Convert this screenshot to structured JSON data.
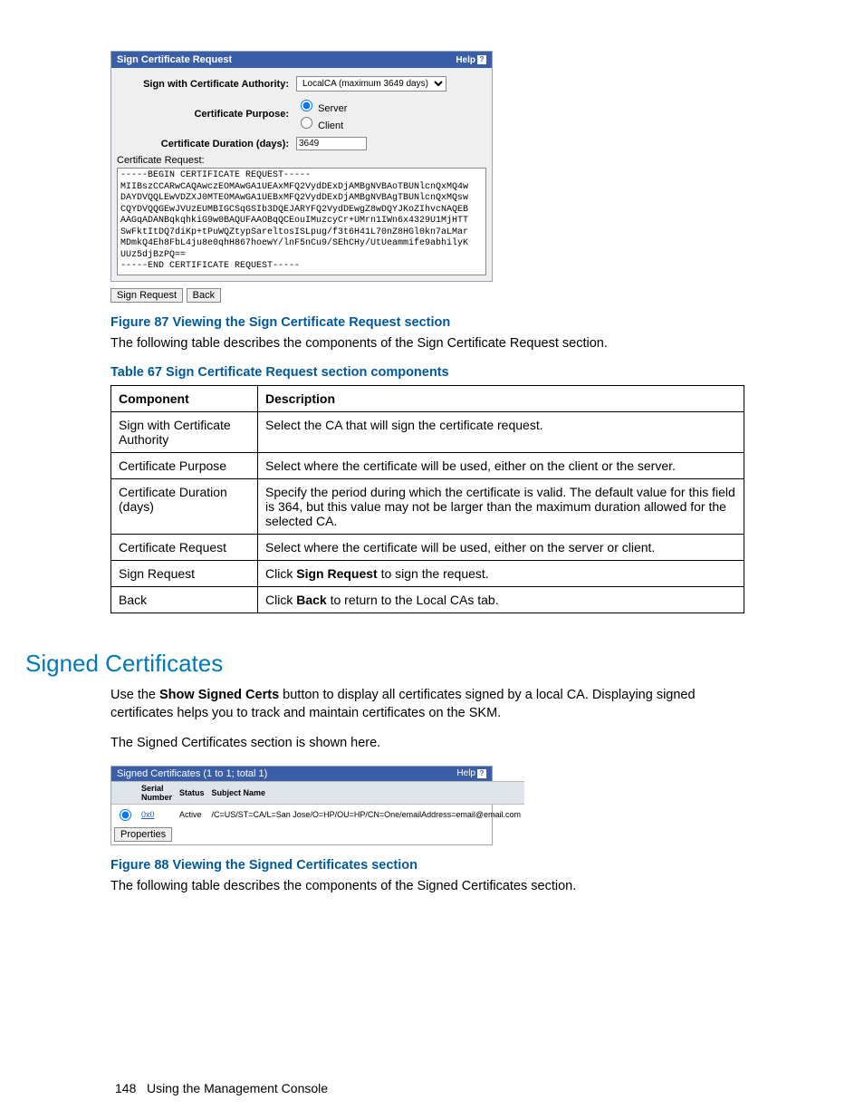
{
  "panel1": {
    "title": "Sign Certificate Request",
    "help": "Help",
    "labels": {
      "sign_with": "Sign with Certificate Authority:",
      "purpose": "Certificate Purpose:",
      "duration": "Certificate Duration (days):",
      "cert_request": "Certificate Request:"
    },
    "values": {
      "ca_select": "LocalCA (maximum 3649 days)",
      "radio_server": "Server",
      "radio_client": "Client",
      "duration": "3649"
    },
    "cert_text": "-----BEGIN CERTIFICATE REQUEST-----\nMIIBszCCARwCAQAwczEOMAwGA1UEAxMFQ2VydDExDjAMBgNVBAoTBUNlcnQxMQ4w\nDAYDVQQLEwVDZXJ0MTEOMAwGA1UEBxMFQ2VydDExDjAMBgNVBAgTBUNlcnQxMQsw\nCQYDVQQGEwJVUzEUMBIGCSqGSIb3DQEJARYFQ2VydDEwgZ8wDQYJKoZIhvcNAQEB\nAAGqADANBqkqhkiG9w0BAQUFAAOBqQCEouIMuzcyCr+UMrn1IWn6x4329U1MjHTT\nSwFktItDQ7diKp+tPuWQZtypSareltosISLpug/f3t6H41L70nZ8HGl0kn7aLMar\nMDmkQ4Eh8FbL4ju8e0qhH867hoewY/lnF5nCu9/SEhCHy/UtUeammife9abhilyK\nUUz5djBzPQ==\n-----END CERTIFICATE REQUEST-----",
    "buttons": {
      "sign": "Sign Request",
      "back": "Back"
    }
  },
  "figure87": "Figure 87 Viewing the Sign Certificate Request section",
  "text87": "The following table describes the components of the Sign Certificate Request section.",
  "table67_title": "Table 67 Sign Certificate Request section components",
  "table67": {
    "head": {
      "c1": "Component",
      "c2": "Description"
    },
    "rows": [
      {
        "c1": "Sign with Certificate Authority",
        "c2": "Select the CA that will sign the certificate request."
      },
      {
        "c1": "Certificate Purpose",
        "c2": "Select where the certificate will be used, either on the client or the server."
      },
      {
        "c1": "Certificate Duration (days)",
        "c2": "Specify the period during which the certificate is valid. The default value for this field is 364, but this value may not be larger than the maximum duration allowed for the selected CA."
      },
      {
        "c1": "Certificate Request",
        "c2": "Select where the certificate will be used, either on the server or client."
      },
      {
        "c1": "Sign Request",
        "c2_pre": "Click ",
        "c2_bold": "Sign Request",
        "c2_post": " to sign the request."
      },
      {
        "c1": "Back",
        "c2_pre": "Click ",
        "c2_bold": "Back",
        "c2_post": " to return to the Local CAs tab."
      }
    ]
  },
  "h2_signed": "Signed Certificates",
  "signed_para1_pre": "Use the ",
  "signed_para1_bold": "Show Signed Certs",
  "signed_para1_post": " button to display all certificates signed by a local CA. Displaying signed certificates helps you to track and maintain certificates on the SKM.",
  "signed_para2": "The Signed Certificates section is shown here.",
  "panel2": {
    "title": "Signed Certificates (1 to 1; total 1)",
    "help": "Help",
    "head": {
      "serial": "Serial Number",
      "status": "Status",
      "subject": "Subject Name"
    },
    "row": {
      "serial_link": "0x0",
      "status": "Active",
      "subject": "/C=US/ST=CA/L=San Jose/O=HP/OU=HP/CN=One/emailAddress=email@email.com"
    },
    "button": "Properties"
  },
  "figure88": "Figure 88 Viewing the Signed Certificates section",
  "text88": "The following table describes the components of the Signed Certificates section.",
  "footer": {
    "page": "148",
    "text": "Using the Management Console"
  }
}
